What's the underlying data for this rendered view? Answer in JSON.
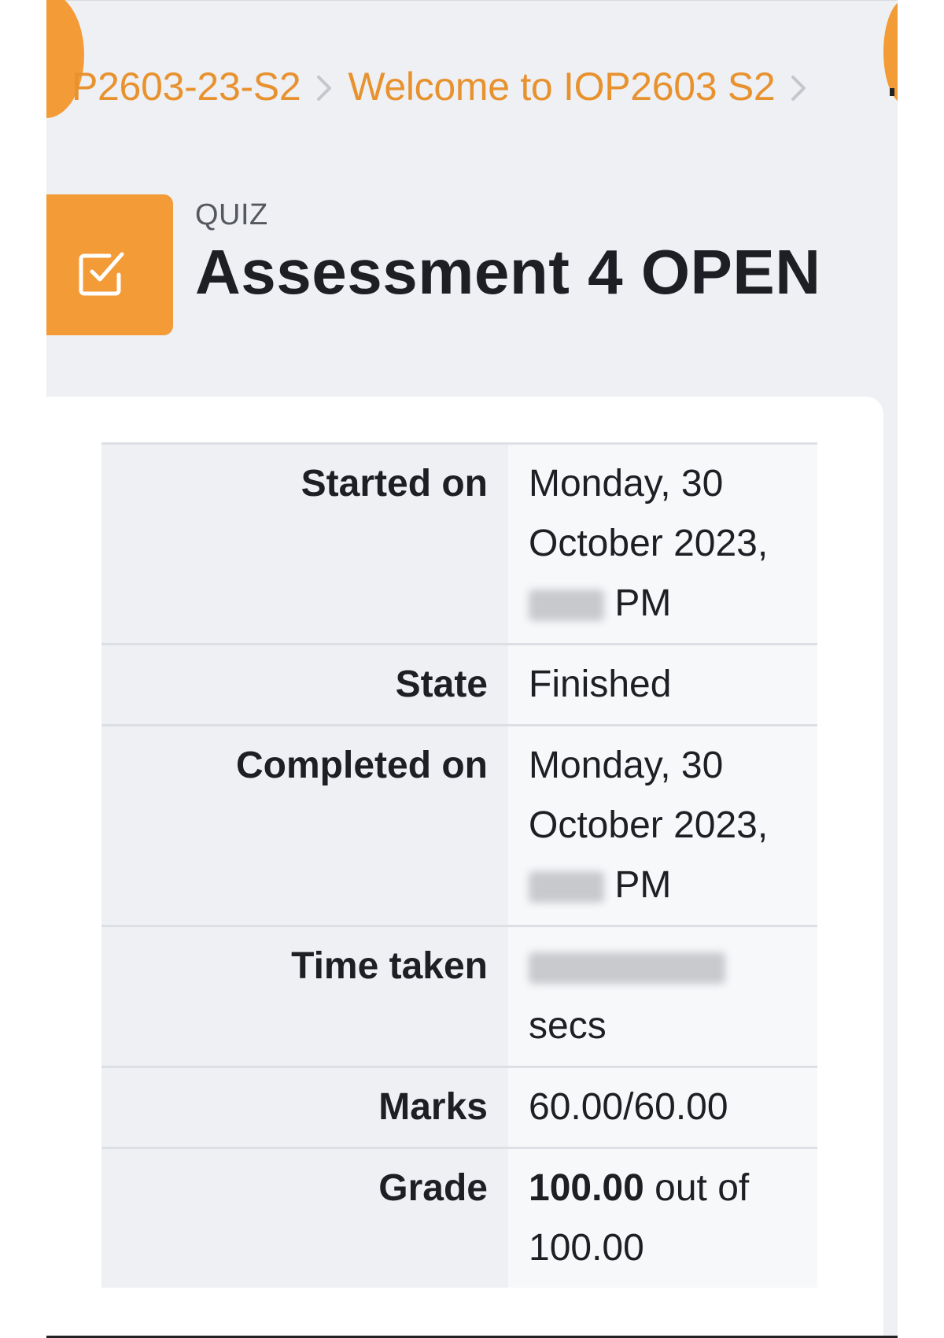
{
  "breadcrumb": {
    "items": [
      "P2603-23-S2",
      "Welcome to IOP2603 S2"
    ],
    "separator": "chevron-right-icon"
  },
  "header": {
    "activity_type": "QUIZ",
    "title": "Assessment 4 OPEN",
    "icon": "quiz-checkbox-icon",
    "accent_color": "#f39b37"
  },
  "summary": {
    "started_on": {
      "label": "Started on",
      "value_prefix": "Monday, 30 October 2023,",
      "value_suffix": "PM"
    },
    "state": {
      "label": "State",
      "value": "Finished"
    },
    "completed_on": {
      "label": "Completed on",
      "value_prefix": "Monday, 30 October 2023,",
      "value_suffix": "PM"
    },
    "time_taken": {
      "label": "Time taken",
      "value_suffix": "secs"
    },
    "marks": {
      "label": "Marks",
      "value": "60.00/60.00"
    },
    "grade": {
      "label": "Grade",
      "value_bold": "100.00",
      "value_rest": "out of 100.00"
    }
  },
  "colors": {
    "accent": "#f39b37",
    "link": "#e8922f",
    "page_background": "#eef0f4"
  }
}
